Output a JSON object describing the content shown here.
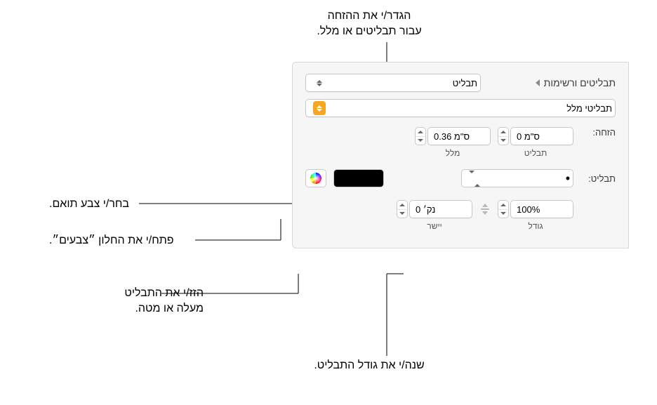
{
  "callouts": {
    "indent": "הגדר/י את ההזחה\nעבור תבליטים או מלל.",
    "match_color": "בחר/י צבע תואם.",
    "open_colors": "פתח/י את החלון ״צבעים״.",
    "shift": "הזז/י את התבליט\nמעלה או מטה.",
    "size": "שנה/י את גודל התבליט."
  },
  "section_title": "תבליטים ורשימות",
  "popup_main": "תבליט",
  "popup_style": "תבליטי מלל",
  "labels": {
    "indent": "הזחה:",
    "bullet": "תבליט:",
    "text_sub": "מלל",
    "bullet_sub": "תבליט",
    "size_sub": "גודל",
    "align_sub": "יישר"
  },
  "values": {
    "bullet_indent": "0 ס\"מ",
    "text_indent": "0.36 ס\"מ",
    "bullet_symbol": "•",
    "size": "100%",
    "align": "0 נק׳"
  }
}
